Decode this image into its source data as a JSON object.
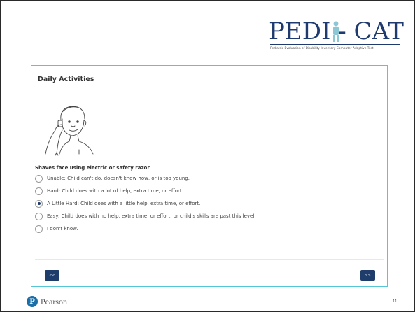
{
  "logo": {
    "text": "PEDI  - CAT",
    "subtitle": "Pediatric Evaluation of Disability Inventory Computer Adaptive Test"
  },
  "card": {
    "title": "Daily Activities",
    "question": "Shaves face using electric or safety razor",
    "options": [
      {
        "label": "Unable: Child can't do, doesn't know how, or is too young.",
        "selected": false
      },
      {
        "label": "Hard: Child does with a lot of help, extra time, or effort.",
        "selected": false
      },
      {
        "label": "A Little Hard: Child does with a little help, extra time, or effort.",
        "selected": true
      },
      {
        "label": "Easy: Child does with no help, extra time, or effort, or child's skills are past this level.",
        "selected": false
      },
      {
        "label": "I don't know.",
        "selected": false
      }
    ],
    "prev_label": "<<",
    "next_label": ">>"
  },
  "footer": {
    "brand": "Pearson",
    "page_number": "11"
  }
}
